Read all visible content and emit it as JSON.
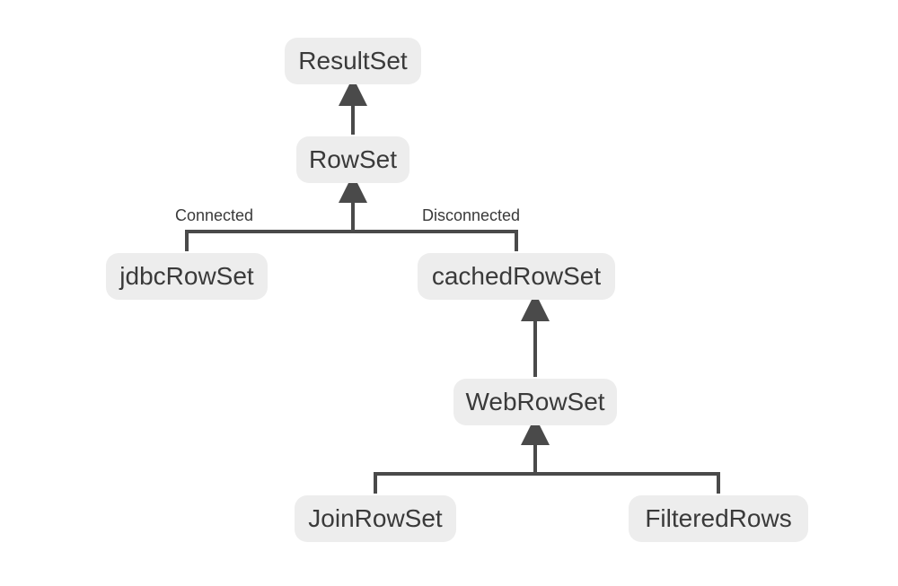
{
  "diagram": {
    "type": "hierarchy",
    "nodes": {
      "resultset": {
        "label": "ResultSet"
      },
      "rowset": {
        "label": "RowSet"
      },
      "jdbcrowset": {
        "label": "jdbcRowSet"
      },
      "cachedrowset": {
        "label": "cachedRowSet"
      },
      "webrowset": {
        "label": "WebRowSet"
      },
      "joinrowset": {
        "label": "JoinRowSet"
      },
      "filteredrows": {
        "label": "FilteredRows"
      }
    },
    "edges": [
      {
        "from": "rowset",
        "to": "resultset"
      },
      {
        "from": "jdbcrowset",
        "to": "rowset",
        "label": "Connected"
      },
      {
        "from": "cachedrowset",
        "to": "rowset",
        "label": "Disconnected"
      },
      {
        "from": "webrowset",
        "to": "cachedrowset"
      },
      {
        "from": "joinrowset",
        "to": "webrowset"
      },
      {
        "from": "filteredrows",
        "to": "webrowset"
      }
    ],
    "edge_labels": {
      "connected": "Connected",
      "disconnected": "Disconnected"
    },
    "colors": {
      "node_bg": "#ededed",
      "node_text": "#3a3a3a",
      "arrow": "#4a4a4a",
      "bg": "#ffffff"
    }
  }
}
